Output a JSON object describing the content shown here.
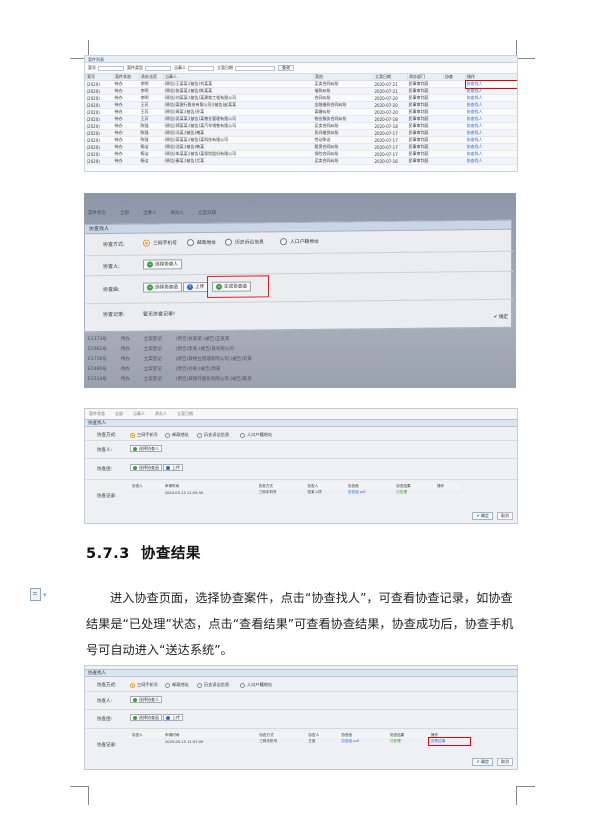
{
  "screenshot1": {
    "title": "案件列表",
    "filters": {
      "case_no_label": "案号",
      "type_label": "案件类型",
      "parties_label": "当事人",
      "date_label": "立案日期",
      "query_button": "查询"
    },
    "columns": [
      "案号",
      "案件状态",
      "承办法官",
      "当事人",
      "案由",
      "立案日期",
      "承办部门",
      "协查",
      "操作"
    ],
    "rows": [
      [
        "(2020)",
        "待办",
        "李明",
        "(原告)王某某;(被告)刘某某",
        "买卖合同纠纷",
        "2020-07-21",
        "民事审判庭",
        "",
        "协查找人"
      ],
      [
        "(2020)",
        "待办",
        "李明",
        "(原告)张某某;(被告)陈某某",
        "借款纠纷",
        "2020-07-21",
        "民事审判庭",
        "",
        "协查找人"
      ],
      [
        "(2020)",
        "待办",
        "李明",
        "(原告)刘某某;(被告)某建筑工程有限公司",
        "合同纠纷",
        "2020-07-20",
        "民事审判庭",
        "",
        "协查找人"
      ],
      [
        "(2020)",
        "待办",
        "王芳",
        "(原告)某银行股份有限公司;(被告)赵某某",
        "金融借款合同纠纷",
        "2020-07-20",
        "民事审判庭",
        "",
        "协查找人"
      ],
      [
        "(2020)",
        "待办",
        "王芳",
        "(原告)周某;(被告)孙某",
        "离婚纠纷",
        "2020-07-20",
        "民事审判庭",
        "",
        "协查找人"
      ],
      [
        "(2020)",
        "待办",
        "王芳",
        "(原告)吴某某;(被告)某物业管理有限公司",
        "物业服务合同纠纷",
        "2020-07-18",
        "民事审判庭",
        "",
        "协查找人"
      ],
      [
        "(2020)",
        "待办",
        "陈强",
        "(原告)郑某某;(被告)某汽车销售有限公司",
        "买卖合同纠纷",
        "2020-07-18",
        "民事审判庭",
        "",
        "协查找人"
      ],
      [
        "(2020)",
        "待办",
        "陈强",
        "(原告)冯某;(被告)褚某",
        "民间借贷纠纷",
        "2020-07-17",
        "民事审判庭",
        "",
        "协查找人"
      ],
      [
        "(2020)",
        "待办",
        "陈强",
        "(原告)蒋某某;(被告)某科技有限公司",
        "劳动争议",
        "2020-07-17",
        "民事审判庭",
        "",
        "协查找人"
      ],
      [
        "(2020)",
        "待办",
        "杨洁",
        "(原告)沈某;(被告)韩某",
        "租赁合同纠纷",
        "2020-07-17",
        "民事审判庭",
        "",
        "协查找人"
      ],
      [
        "(2020)",
        "待办",
        "杨洁",
        "(原告)朱某某;(被告)某保险股份有限公司",
        "保险合同纠纷",
        "2020-07-17",
        "民事审判庭",
        "",
        "协查找人"
      ],
      [
        "(2020)",
        "待办",
        "杨洁",
        "(原告)秦某;(被告)尤某",
        "买卖合同纠纷",
        "2020-07-16",
        "民事审判庭",
        "",
        "协查找人"
      ]
    ]
  },
  "screenshot2": {
    "bg_labels": [
      "案件状态",
      "全部",
      "当事人",
      "承办人",
      "立案日期"
    ],
    "title": "协查找人",
    "method_label": "协查方式:",
    "methods": [
      "三网手机号",
      "邮政地址",
      "历史诉讼信息",
      "人口户籍地址"
    ],
    "person_label": "协查人:",
    "select_person": "选择协查人",
    "doc_label": "协查函:",
    "select_doc": "选择协查函",
    "upload": "上传",
    "generate_doc": "生成协查函",
    "record_label": "协查记录:",
    "record_empty": "暂无协查记录!",
    "ok": "确定",
    "bg_rows": [
      [
        "E1173号",
        "待办",
        "立案登记",
        "(原告)张某某;(被告)王某某"
      ],
      [
        "E2962号",
        "待办",
        "立案登记",
        "(原告)李某;(被告)某有限公司"
      ],
      [
        "E1716号",
        "待办",
        "立案登记",
        "(原告)某物业管理有限公司;(被告)刘某"
      ],
      [
        "E1480号",
        "待办",
        "立案登记",
        "(原告)孙某;(被告)周某"
      ],
      [
        "E1514号",
        "待办",
        "立案登记",
        "(原告)某银行股份有限公司;(被告)陈某"
      ]
    ]
  },
  "screenshot3": {
    "bg_labels": [
      "案件状态",
      "全部",
      "当事人",
      "承办人",
      "立案日期"
    ],
    "title": "协查找人",
    "method_label": "协查方式:",
    "methods": [
      "三网手机号",
      "邮政地址",
      "历史诉讼信息",
      "人口户籍地址"
    ],
    "person_label": "协查人:",
    "select_person": "选择协查人",
    "doc_label": "协查函:",
    "select_doc": "选择协查函",
    "upload": "上传",
    "record_label": "协查记录:",
    "record_columns": [
      "协查人",
      "申请时间",
      "协查方式",
      "协查人",
      "协查函",
      "协查结果",
      "操作"
    ],
    "record_row": [
      "",
      "2020-05-15 11:05:30",
      "三网手机号",
      "张某,1项",
      "协查函.pdf",
      "已处理",
      ""
    ],
    "ok": "确定",
    "cancel": "取消"
  },
  "section": {
    "number": "5.7.3",
    "title": "协查结果",
    "paragraph": "进入协查页面，选择协查案件，点击“协查找人”，可查看协查记录，如协查结果是“已处理”状态，点击“查看结果”可查看协查结果，协查成功后，协查手机号可自动进入“送达系统”。"
  },
  "screenshot4": {
    "title": "协查找人",
    "method_label": "协查方式:",
    "methods": [
      "三网手机号",
      "邮政地址",
      "历史诉讼信息",
      "人口户籍地址"
    ],
    "person_label": "协查人:",
    "select_person": "选择协查人",
    "doc_label": "协查函:",
    "select_doc": "选择协查函",
    "upload": "上传",
    "record_label": "协查记录:",
    "record_columns": [
      "协查人",
      "申请时间",
      "协查方式",
      "协查人",
      "协查函",
      "协查结果",
      "操作"
    ],
    "record_row": [
      "",
      "2020-05-15 11:57:09",
      "三网手机号",
      "王某",
      "协查函.pdf",
      "已处理",
      "查看结果"
    ],
    "ok": "确定",
    "cancel": "取消"
  }
}
